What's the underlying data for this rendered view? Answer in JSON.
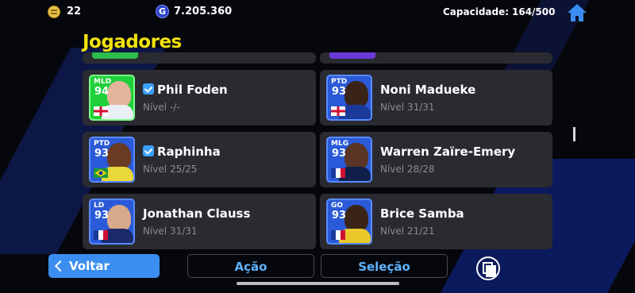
{
  "status": {
    "coins": "22",
    "gp": "7.205.360",
    "gp_icon_letter": "G",
    "capacity_label": "Capacidade:",
    "capacity_value": "164/500"
  },
  "page_title": "Jogadores",
  "players": [
    {
      "name": "Phil Foden",
      "level": "Nível -/-",
      "position": "MLD",
      "rating": "94",
      "verified": true,
      "card_color": "#1fd03a",
      "flag": "england"
    },
    {
      "name": "Noni Madueke",
      "level": "Nível 31/31",
      "position": "PTD",
      "rating": "93",
      "verified": false,
      "card_color": "#2a5ad8",
      "flag": "england"
    },
    {
      "name": "Raphinha",
      "level": "Nível 25/25",
      "position": "PTD",
      "rating": "93",
      "verified": true,
      "card_color": "#2a5ad8",
      "flag": "brazil"
    },
    {
      "name": "Warren Zaïre-Emery",
      "level": "Nível 28/28",
      "position": "MLG",
      "rating": "93",
      "verified": false,
      "card_color": "#2a5ad8",
      "flag": "france"
    },
    {
      "name": "Jonathan Clauss",
      "level": "Nível 31/31",
      "position": "LD",
      "rating": "93",
      "verified": false,
      "card_color": "#2a5ad8",
      "flag": "france"
    },
    {
      "name": "Brice Samba",
      "level": "Nível 21/21",
      "position": "GO",
      "rating": "93",
      "verified": false,
      "card_color": "#2a5ad8",
      "flag": "france"
    }
  ],
  "buttons": {
    "back": "Voltar",
    "action": "Ação",
    "selection": "Seleção"
  },
  "colors": {
    "accent_blue": "#3b8ef0",
    "title_yellow": "#f2e20c",
    "link_blue": "#5eb3ff",
    "card_bg": "#2a2b31"
  }
}
